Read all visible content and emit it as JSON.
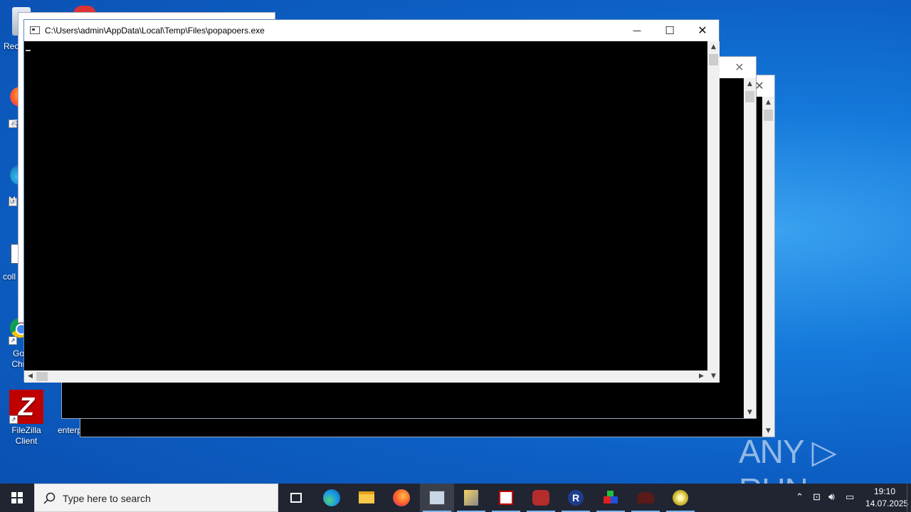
{
  "desktop": {
    "icons": [
      {
        "label": "Rec",
        "icon": "recycle-bin-icon"
      },
      {
        "label": "F",
        "icon": "firefox-icon"
      },
      {
        "label": "M",
        "icon": "edge-icon"
      },
      {
        "label": "coll",
        "icon": "word-icon"
      },
      {
        "label": "Go Chr",
        "icon": "chrome-icon"
      },
      {
        "label": "FileZilla Client",
        "icon": "filezilla-icon"
      },
      {
        "label": "enterp",
        "icon": "file-icon"
      }
    ]
  },
  "console_window": {
    "title": "C:\\Users\\admin\\AppData\\Local\\Temp\\Files\\popapoers.exe",
    "minimize": "—",
    "maximize": "☐",
    "close": "✕"
  },
  "taskbar": {
    "search_placeholder": "Type here to search",
    "apps": [
      {
        "name": "task-view",
        "icon": "task-view-icon"
      },
      {
        "name": "edge",
        "icon": "edge-icon"
      },
      {
        "name": "file-explorer",
        "icon": "folder-icon"
      },
      {
        "name": "firefox",
        "icon": "firefox-icon"
      },
      {
        "name": "console",
        "icon": "console-app-icon",
        "active": true
      },
      {
        "name": "tool-a",
        "icon": "tools-icon"
      },
      {
        "name": "tool-b",
        "icon": "grid-app-icon"
      },
      {
        "name": "tool-c",
        "icon": "red-app-icon"
      },
      {
        "name": "tool-d",
        "icon": "r-app-icon"
      },
      {
        "name": "tool-e",
        "icon": "boxes-app-icon"
      },
      {
        "name": "tool-f",
        "icon": "dark-app-icon"
      },
      {
        "name": "tool-g",
        "icon": "yellow-app-icon"
      }
    ],
    "time": "19:10",
    "date": "14.07.2025"
  },
  "watermark": "ANY ▷ RUN",
  "colors": {
    "taskbar": "#202531",
    "console": "#000000",
    "desktop": "#0d5fc4"
  }
}
